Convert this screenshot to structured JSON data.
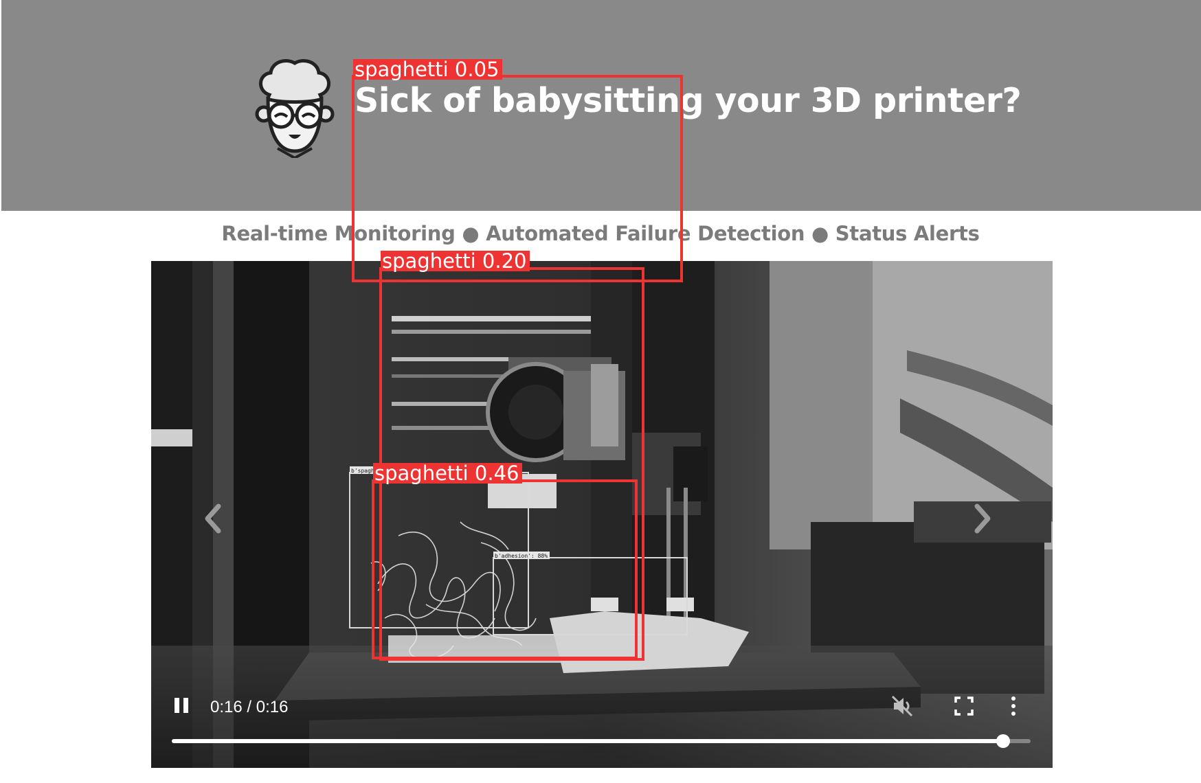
{
  "header": {
    "headline": "Sick of babysitting your 3D printer?",
    "mascot_icon": "grandma-face-logo-icon",
    "background": "#898989"
  },
  "tagline": "Real-time Monitoring ● Automated Failure Detection ● Status Alerts",
  "video": {
    "time_display": "0:16 / 0:16",
    "playing": true,
    "muted": true,
    "progress_fraction": 0.968,
    "inner_labels": {
      "spaghetti": "b'spaghetti': 90%",
      "adhesion": "b'adhesion': 88%"
    },
    "controls": {
      "pause_icon": "pause-icon",
      "mute_icon": "muted-speaker-icon",
      "fullscreen_icon": "fullscreen-icon",
      "more_icon": "more-vertical-icon",
      "prev_icon": "chevron-left-icon",
      "next_icon": "chevron-right-icon"
    }
  },
  "detections": [
    {
      "label": "spaghetti  0.05"
    },
    {
      "label": "spaghetti  0.20"
    },
    {
      "label": "spaghetti  0.46"
    }
  ],
  "colors": {
    "detection": "#ee3333",
    "tagline": "#7b7b7b",
    "headline": "#ffffff"
  }
}
